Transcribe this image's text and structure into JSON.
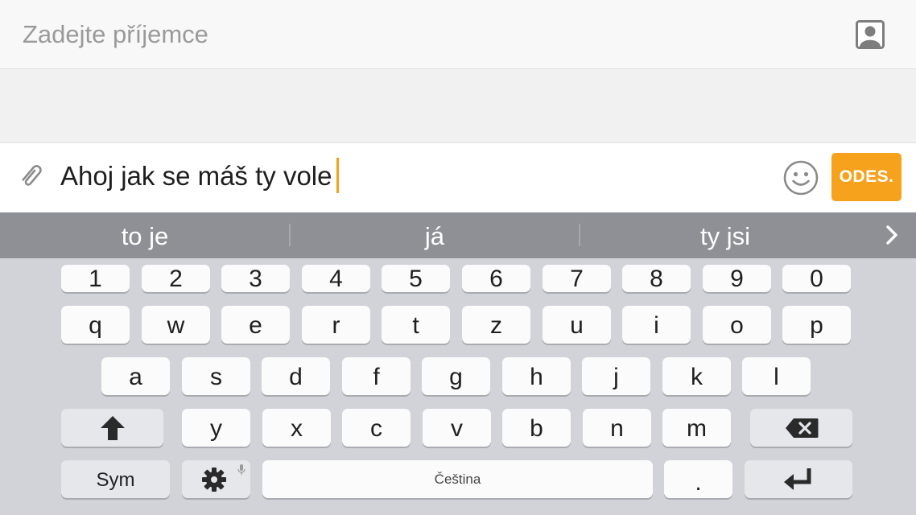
{
  "recipient": {
    "placeholder": "Zadejte příjemce",
    "contacts_icon": "contact-person-icon"
  },
  "composer": {
    "attach_icon": "paperclip-icon",
    "message": "Ahoj jak se máš ty vole",
    "emoji_icon": "smiley-icon",
    "send_label": "ODES."
  },
  "suggestions": {
    "items": [
      "to je",
      "já",
      "ty jsi"
    ],
    "next_icon": "chevron-right-icon"
  },
  "keyboard": {
    "row_numbers": [
      "1",
      "2",
      "3",
      "4",
      "5",
      "6",
      "7",
      "8",
      "9",
      "0"
    ],
    "row_top": [
      "q",
      "w",
      "e",
      "r",
      "t",
      "z",
      "u",
      "i",
      "o",
      "p"
    ],
    "row_home": [
      "a",
      "s",
      "d",
      "f",
      "g",
      "h",
      "j",
      "k",
      "l"
    ],
    "row_bottom": [
      "y",
      "x",
      "c",
      "v",
      "b",
      "n",
      "m"
    ],
    "shift_icon": "shift-arrow-icon",
    "backspace_icon": "backspace-icon",
    "sym_label": "Sym",
    "settings_icon": "gear-icon",
    "mic_icon": "microphone-icon",
    "space_label": "Čeština",
    "period_label": ".",
    "enter_icon": "enter-icon"
  },
  "colors": {
    "accent": "#f7a21c",
    "suggestion_bar": "#8f9095",
    "keyboard_bg": "#d1d3d9",
    "key_bg": "#fbfbfb",
    "function_key_bg": "#e6e7eb"
  }
}
